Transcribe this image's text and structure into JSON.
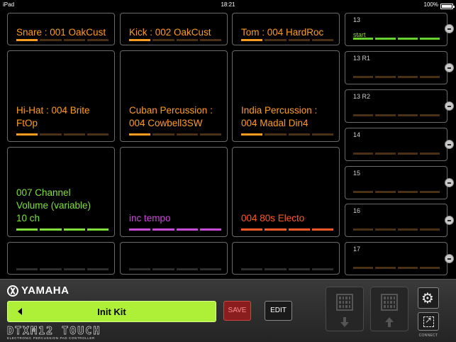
{
  "status_bar": {
    "device": "iPad",
    "time": "18:21",
    "battery": "100%"
  },
  "colors": {
    "orange": "#ff9d1e",
    "green": "#7fe03a",
    "purple": "#c84ad8",
    "red_orange": "#ff5a24",
    "kit_green": "#adf037",
    "save_red": "#8a1e1e"
  },
  "pads": [
    {
      "label": "Snare : 001 OakCust",
      "color": "#ff9d1e"
    },
    {
      "label": "Kick : 002 OakCust",
      "color": "#ff9d1e"
    },
    {
      "label": "Tom : 004 HardRoc",
      "color": "#ff9d1e"
    },
    {
      "label": "Hi-Hat : 004 Brite FtOp",
      "color": "#ff9d1e"
    },
    {
      "label": "Cuban Percussion : 004 Cowbell3SW",
      "color": "#ff9d1e"
    },
    {
      "label": "India Percussion : 004 Madal Din4",
      "color": "#ff9d1e"
    },
    {
      "label": "007 Channel Volume (variable) 10 ch",
      "color": "#7fe03a"
    },
    {
      "label": "inc tempo",
      "color": "#c84ad8"
    },
    {
      "label": "004 80s Electo",
      "color": "#ff5a24"
    },
    {
      "label": ""
    },
    {
      "label": ""
    },
    {
      "label": ""
    }
  ],
  "side_slots": [
    {
      "label": "13",
      "sub": "start"
    },
    {
      "label": "13 R1"
    },
    {
      "label": "13 R2"
    },
    {
      "label": "14"
    },
    {
      "label": "15"
    },
    {
      "label": "16"
    },
    {
      "label": "17"
    }
  ],
  "brand": "YAMAHA",
  "kit": {
    "name": "Init Kit"
  },
  "buttons": {
    "save": "SAVE",
    "edit": "EDIT"
  },
  "product": {
    "name": "DTXM12 TOUCH",
    "tagline": "ELECTRONIC PERCUSSION PAD CONTROLLER"
  },
  "connect_label": "CONNECT",
  "icons": {
    "settings": "gear-icon",
    "connect": "expand-icon",
    "kit_prev": "caret-left-icon",
    "load_down": "arrow-down-icon",
    "load_up": "arrow-up-icon",
    "slot_remove": "minus-circle-icon"
  }
}
